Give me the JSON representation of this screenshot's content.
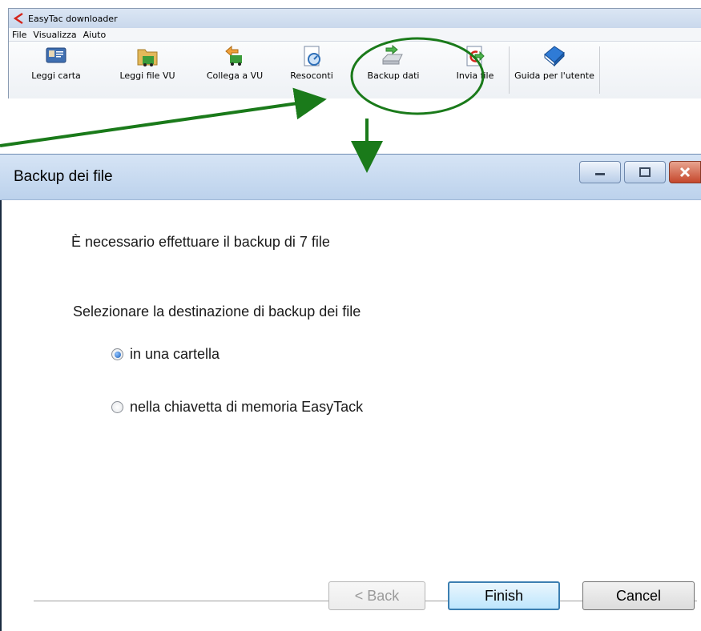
{
  "app": {
    "title": "EasyTac downloader",
    "menu": [
      "File",
      "Visualizza",
      "Aiuto"
    ],
    "toolbar": [
      {
        "label": "Leggi carta",
        "icon": "card-reader-icon"
      },
      {
        "label": "Leggi file VU",
        "icon": "read-vu-file-icon"
      },
      {
        "label": "Collega a VU",
        "icon": "connect-vu-icon"
      },
      {
        "label": "Resoconti",
        "icon": "reports-icon"
      },
      {
        "label": "Backup dati",
        "icon": "backup-drive-icon"
      },
      {
        "label": "Invia file",
        "icon": "send-file-icon"
      },
      {
        "label": "Guida per l'utente",
        "icon": "user-guide-book-icon"
      }
    ]
  },
  "dialog": {
    "title": "Backup dei file",
    "message": "È necessario effettuare il backup di 7 file",
    "prompt": "Selezionare la destinazione di backup dei file",
    "options": [
      {
        "label": "in una cartella",
        "selected": true
      },
      {
        "label": "nella chiavetta di memoria EasyTack",
        "selected": false
      }
    ],
    "buttons": {
      "back": "< Back",
      "finish": "Finish",
      "cancel": "Cancel"
    }
  },
  "colors": {
    "annotation_green": "#1a7a1a",
    "title_gradient": "#c9d8ec",
    "close_red": "#c5472c"
  }
}
